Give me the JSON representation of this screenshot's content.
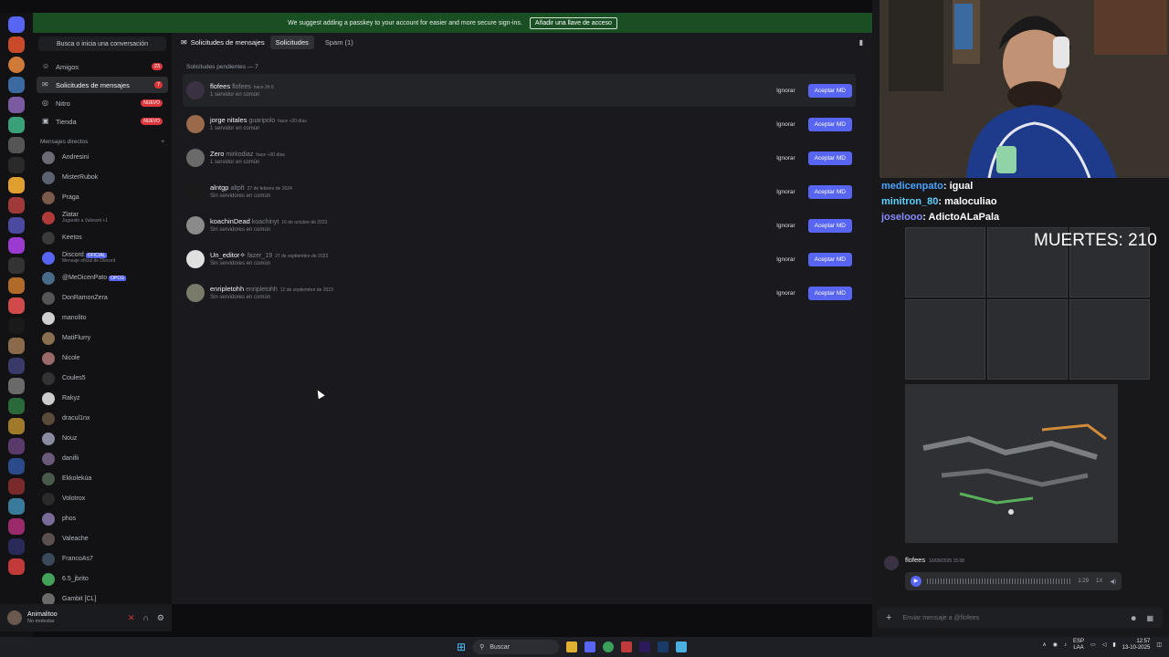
{
  "banner": {
    "text": "We suggest adding a passkey to your account for easier and more secure sign-ins.",
    "button": "Añadir una llave de acceso"
  },
  "sidebar": {
    "search": "Busca o inicia una conversación",
    "nav": [
      {
        "label": "Amigos",
        "badge": "23",
        "icon": "friends-icon"
      },
      {
        "label": "Solicitudes de mensajes",
        "badge": "7",
        "icon": "inbox-icon"
      },
      {
        "label": "Nitro",
        "badge": "NUEVO",
        "icon": "nitro-icon"
      },
      {
        "label": "Tienda",
        "badge": "NUEVO",
        "icon": "shop-icon"
      }
    ],
    "dm_header": "Mensajes directos",
    "dms": [
      {
        "name": "Andresini",
        "color": "#6b6b75"
      },
      {
        "name": "MisterRubok",
        "color": "#5c6170"
      },
      {
        "name": "Praga",
        "color": "#7a5a4a"
      },
      {
        "name": "Zlatar",
        "sub": "Jugando a Valorant +1",
        "color": "#b03a3a"
      },
      {
        "name": "Keetos",
        "color": "#3a3a3a"
      },
      {
        "name": "Discord",
        "sub": "Mensaje oficial de Discord",
        "tag": "OFICIAL",
        "color": "#5865f2"
      },
      {
        "name": "@MeDicenPato",
        "tag": "OPCG",
        "color": "#4a6a8a"
      },
      {
        "name": "DonRamonZera",
        "color": "#555"
      },
      {
        "name": "manolito",
        "color": "#d0d0d0"
      },
      {
        "name": "MatiFlurry",
        "color": "#8a7050"
      },
      {
        "name": "Nicole",
        "color": "#9a6a6a"
      },
      {
        "name": "Coules5",
        "color": "#333"
      },
      {
        "name": "Rakyz",
        "color": "#ccc"
      },
      {
        "name": "dracul1nx",
        "color": "#5a4a3a"
      },
      {
        "name": "Nouz",
        "color": "#8a8aa0"
      },
      {
        "name": "danifii",
        "color": "#6a5a7a"
      },
      {
        "name": "Ekkolekúa",
        "color": "#4a5a4a"
      },
      {
        "name": "Volotrox",
        "color": "#2a2a2a"
      },
      {
        "name": "phos",
        "color": "#7a6a9a"
      },
      {
        "name": "Valeache",
        "color": "#5a5050"
      },
      {
        "name": "FrancoAs7",
        "color": "#3a4a5a"
      },
      {
        "name": "6.5_jbrito",
        "color": "#43a25a"
      },
      {
        "name": "Gambit [CL]",
        "color": "#6a6a6a"
      }
    ]
  },
  "user": {
    "name": "Animalitoo",
    "status": "No molestar"
  },
  "main": {
    "title": "Solicitudes de mensajes",
    "tab_requests": "Solicitudes",
    "tab_spam": "Spam (1)",
    "pending": "Solicitudes pendientes — 7",
    "ignore": "Ignorar",
    "accept": "Aceptar MD",
    "requests": [
      {
        "name": "flofees",
        "handle": "flofees",
        "when": "hace 2h 6",
        "sub": "1 servidor en común",
        "color": "#3a3242"
      },
      {
        "name": "jorge nitales",
        "handle": "guaripolo",
        "when": "hace +30 días",
        "sub": "1 servidor en común",
        "color": "#9a6a4a"
      },
      {
        "name": "Zero",
        "handle": "mirkodiaz",
        "when": "hace +30 días",
        "sub": "1 servidor en común",
        "color": "#6a6a6a"
      },
      {
        "name": "alntgp",
        "handle": "altpft",
        "when": "27 de febrero de 2024",
        "sub": "Sin servidores en común",
        "color": "#1a1a1a"
      },
      {
        "name": "koachinDead",
        "handle": "koachinyt",
        "when": "16 de octubre de 2023",
        "sub": "Sin servidores en común",
        "color": "#8a8a8a"
      },
      {
        "name": "Un_editor✧",
        "handle": "fazer_19",
        "when": "27 de septiembre de 2023",
        "sub": "Sin servidores en común",
        "color": "#e0e0e0"
      },
      {
        "name": "enripletohh",
        "handle": "enripletohh",
        "when": "12 de septiembre de 2023",
        "sub": "Sin servidores en común",
        "color": "#7a7a6a"
      }
    ]
  },
  "stream": {
    "chat": [
      {
        "user": "medicenpato",
        "text": ": igual"
      },
      {
        "user": "minitron_80",
        "text": ": maloculiao"
      },
      {
        "user": "joselooo",
        "text": ": AdictoALaPala"
      }
    ],
    "deaths": "MUERTES: 210"
  },
  "message": {
    "author": "flofees",
    "time": "16/09/2025 15:08",
    "duration": "1:29",
    "speed": "1X"
  },
  "chat_input": {
    "placeholder": "Enviar mensaje a @flofees"
  },
  "taskbar": {
    "search": "Buscar",
    "lang_top": "ESP",
    "lang_bottom": "LAA",
    "time": "12:57",
    "date": "13-10-2025"
  }
}
